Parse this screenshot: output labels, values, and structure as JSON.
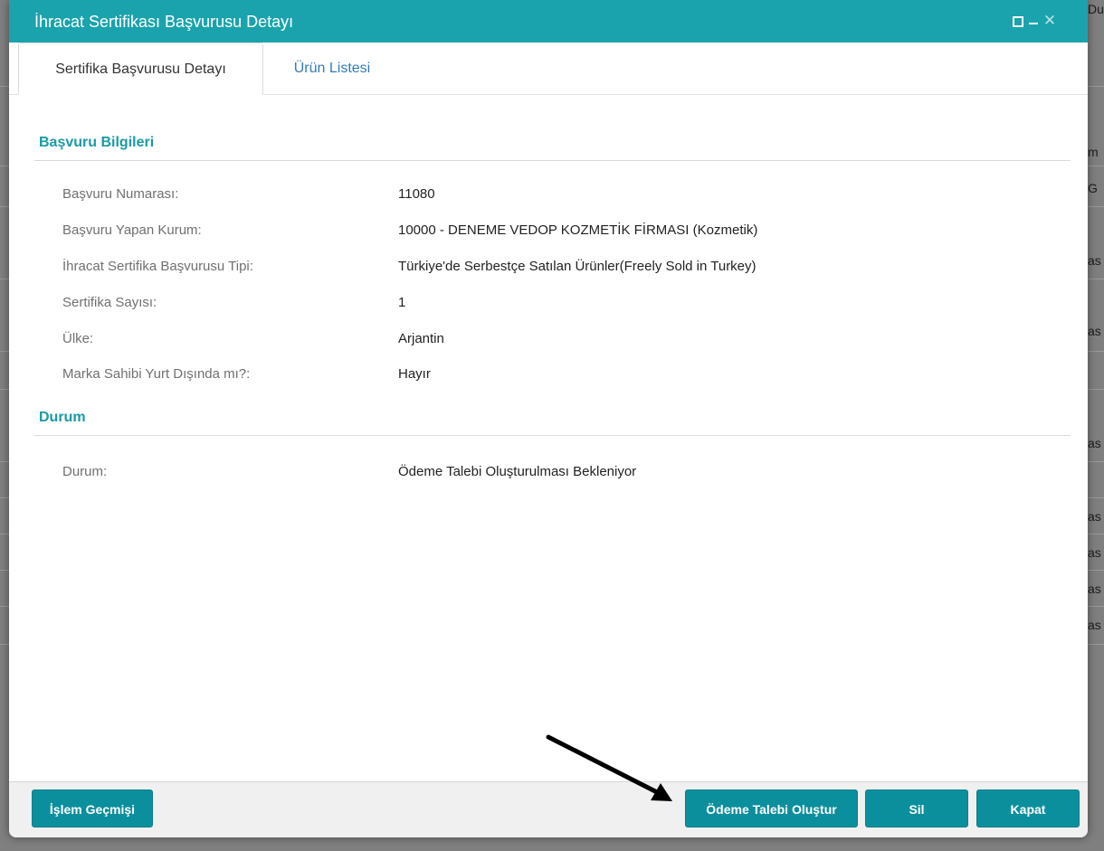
{
  "background": {
    "fragments": [
      "Du",
      "m",
      "G",
      "as",
      "as",
      "as",
      "as",
      "as",
      "as",
      "as"
    ]
  },
  "dialog": {
    "title": "İhracat Sertifikası Başvurusu Detayı",
    "tabs": [
      {
        "label": "Sertifika Başvurusu Detayı",
        "active": true
      },
      {
        "label": "Ürün Listesi",
        "active": false
      }
    ]
  },
  "application_info": {
    "title": "Başvuru Bilgileri",
    "rows": [
      {
        "label": "Başvuru Numarası:",
        "value": "11080"
      },
      {
        "label": "Başvuru Yapan Kurum:",
        "value": "10000 - DENEME VEDOP KOZMETİK FİRMASI (Kozmetik)"
      },
      {
        "label": "İhracat Sertifika Başvurusu Tipi:",
        "value": "Türkiye'de Serbestçe Satılan Ürünler(Freely Sold in Turkey)"
      },
      {
        "label": "Sertifika Sayısı:",
        "value": "1"
      },
      {
        "label": "Ülke:",
        "value": "Arjantin"
      },
      {
        "label": "Marka Sahibi Yurt Dışında mı?:",
        "value": "Hayır"
      }
    ]
  },
  "status": {
    "title": "Durum",
    "rows": [
      {
        "label": "Durum:",
        "value": "Ödeme Talebi Oluşturulması Bekleniyor"
      }
    ]
  },
  "footer": {
    "history_label": "İşlem Geçmişi",
    "payment_label": "Ödeme Talebi Oluştur",
    "delete_label": "Sil",
    "close_label": "Kapat"
  },
  "colors": {
    "titlebar": "#1aa3ac",
    "section_title": "#1a9aa5",
    "button": "#0c8f9d",
    "link": "#337ab7"
  },
  "icons": {
    "maximize": "maximize-icon",
    "minimize": "minimize-icon",
    "close": "close-icon",
    "arrow": "annotation-arrow-icon"
  }
}
